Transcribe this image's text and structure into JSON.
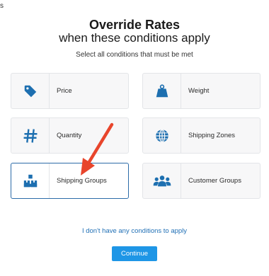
{
  "corner_mark": "s",
  "header": {
    "title": "Override Rates",
    "subtitle": "when these conditions apply",
    "instructions": "Select all conditions that must be met"
  },
  "conditions": [
    {
      "label": "Price",
      "icon": "price-tag-icon",
      "selected": false
    },
    {
      "label": "Weight",
      "icon": "weight-icon",
      "selected": false
    },
    {
      "label": "Quantity",
      "icon": "hash-icon",
      "selected": false
    },
    {
      "label": "Shipping Zones",
      "icon": "globe-icon",
      "selected": false
    },
    {
      "label": "Shipping Groups",
      "icon": "boxes-icon",
      "selected": true
    },
    {
      "label": "Customer Groups",
      "icon": "people-icon",
      "selected": false
    }
  ],
  "footer": {
    "no_conditions_link": "I don't have any conditions to apply",
    "continue_label": "Continue"
  },
  "colors": {
    "icon_blue": "#1d6fb0",
    "selected_border": "#2c6ba8",
    "button_blue": "#1e96e6",
    "link_blue": "#1f6fb5",
    "arrow_red": "#e8452c"
  }
}
